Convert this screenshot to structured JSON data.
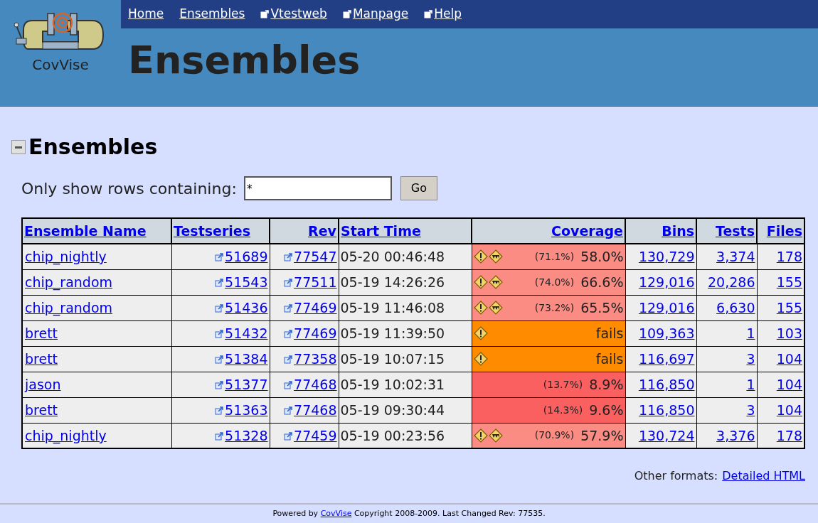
{
  "logo": {
    "name": "CovVise"
  },
  "nav": [
    {
      "label": "Home",
      "external": false
    },
    {
      "label": "Ensembles",
      "external": false
    },
    {
      "label": "Vtestweb",
      "external": true
    },
    {
      "label": "Manpage",
      "external": true
    },
    {
      "label": "Help",
      "external": true
    }
  ],
  "page_title": "Ensembles",
  "section": {
    "title": "Ensembles",
    "expanded": true
  },
  "filter": {
    "label": "Only show rows containing:",
    "value": "*",
    "button": "Go"
  },
  "table": {
    "columns": [
      "Ensemble Name",
      "Testseries",
      "Rev",
      "Start Time",
      "Coverage",
      "Bins",
      "Tests",
      "Files"
    ],
    "rows": [
      {
        "name": "chip_nightly",
        "testseries": "51689",
        "rev": "77547",
        "start": "05-20 00:46:48",
        "coverage": {
          "kind": "partial",
          "warning": true,
          "badge": true,
          "detail": "(71.1%)",
          "value": "58.0%"
        },
        "bins": "130,729",
        "tests": "3,374",
        "files": "178"
      },
      {
        "name": "chip_random",
        "testseries": "51543",
        "rev": "77511",
        "start": "05-19 14:26:26",
        "coverage": {
          "kind": "partial",
          "warning": true,
          "badge": true,
          "detail": "(74.0%)",
          "value": "66.6%"
        },
        "bins": "129,016",
        "tests": "20,286",
        "files": "155"
      },
      {
        "name": "chip_random",
        "testseries": "51436",
        "rev": "77469",
        "start": "05-19 11:46:08",
        "coverage": {
          "kind": "partial",
          "warning": true,
          "badge": true,
          "detail": "(73.2%)",
          "value": "65.5%"
        },
        "bins": "129,016",
        "tests": "6,630",
        "files": "155"
      },
      {
        "name": "brett",
        "testseries": "51432",
        "rev": "77469",
        "start": "05-19 11:39:50",
        "coverage": {
          "kind": "fails",
          "warning": true,
          "badge": false,
          "value": "fails"
        },
        "bins": "109,363",
        "tests": "1",
        "files": "103"
      },
      {
        "name": "brett",
        "testseries": "51384",
        "rev": "77358",
        "start": "05-19 10:07:15",
        "coverage": {
          "kind": "fails",
          "warning": true,
          "badge": false,
          "value": "fails"
        },
        "bins": "116,697",
        "tests": "3",
        "files": "104"
      },
      {
        "name": "jason",
        "testseries": "51377",
        "rev": "77468",
        "start": "05-19 10:02:31",
        "coverage": {
          "kind": "low",
          "warning": false,
          "badge": false,
          "detail": "(13.7%)",
          "value": "8.9%"
        },
        "bins": "116,850",
        "tests": "1",
        "files": "104"
      },
      {
        "name": "brett",
        "testseries": "51363",
        "rev": "77468",
        "start": "05-19 09:30:44",
        "coverage": {
          "kind": "low",
          "warning": false,
          "badge": false,
          "detail": "(14.3%)",
          "value": "9.6%"
        },
        "bins": "116,850",
        "tests": "3",
        "files": "104"
      },
      {
        "name": "chip_nightly",
        "testseries": "51328",
        "rev": "77459",
        "start": "05-19 00:23:56",
        "coverage": {
          "kind": "partial",
          "warning": true,
          "badge": true,
          "detail": "(70.9%)",
          "value": "57.9%"
        },
        "bins": "130,724",
        "tests": "3,376",
        "files": "178"
      }
    ]
  },
  "other_formats": {
    "label": "Other formats:",
    "link": "Detailed HTML"
  },
  "footer": {
    "prefix": "Powered by",
    "link": "CovVise",
    "suffix": "Copyright 2008-2009. Last Changed Rev: 77535."
  }
}
